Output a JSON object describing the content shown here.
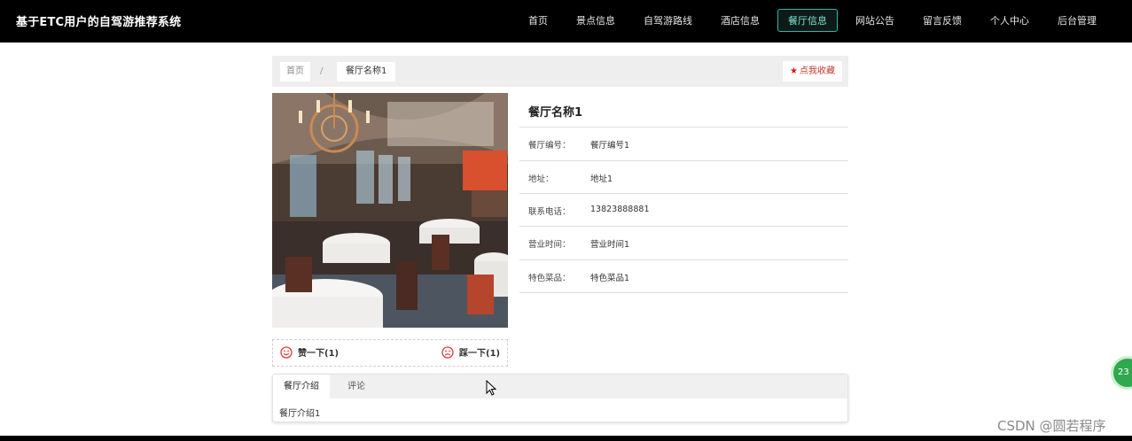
{
  "site": {
    "title": "基于ETC用户的自驾游推荐系统"
  },
  "nav": {
    "items": [
      {
        "label": "首页"
      },
      {
        "label": "景点信息"
      },
      {
        "label": "自驾游路线"
      },
      {
        "label": "酒店信息"
      },
      {
        "label": "餐厅信息"
      },
      {
        "label": "网站公告"
      },
      {
        "label": "留言反馈"
      },
      {
        "label": "个人中心"
      },
      {
        "label": "后台管理"
      }
    ],
    "active": "餐厅信息"
  },
  "breadcrumb": {
    "home": "首页",
    "separator": "/",
    "current": "餐厅名称1"
  },
  "favorite": {
    "icon": "star-icon",
    "label": "点我收藏"
  },
  "restaurant": {
    "name": "餐厅名称1",
    "fields": [
      {
        "label": "餐厅编号：",
        "value": "餐厅编号1"
      },
      {
        "label": "地址：",
        "value": "地址1"
      },
      {
        "label": "联系电话：",
        "value": "13823888881"
      },
      {
        "label": "营业时间：",
        "value": "营业时间1"
      },
      {
        "label": "特色菜品：",
        "value": "特色菜品1"
      }
    ]
  },
  "votes": {
    "like": {
      "label": "赞一下(1)",
      "icon": "smile-icon"
    },
    "dislike": {
      "label": "踩一下(1)",
      "icon": "frown-icon"
    }
  },
  "tabs": [
    {
      "label": "餐厅介绍"
    },
    {
      "label": "评论"
    }
  ],
  "tab_content": "餐厅介绍1",
  "float_badge": "23",
  "watermark": "CSDN @圆若程序",
  "colors": {
    "accent": "#2fb8a6",
    "favorite": "#d8161d",
    "vote_icon": "#e03a3a"
  }
}
